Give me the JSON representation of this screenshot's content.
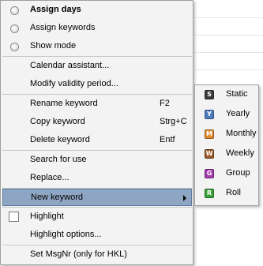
{
  "menu": {
    "mode_items": [
      {
        "label": "Assign days"
      },
      {
        "label": "Assign keywords"
      },
      {
        "label": "Show mode"
      }
    ],
    "calendar_assistant": "Calendar assistant...",
    "modify_validity": "Modify validity period...",
    "rename_keyword": {
      "label": "Rename keyword",
      "shortcut": "F2"
    },
    "copy_keyword": {
      "label": "Copy keyword",
      "shortcut": "Strg+C"
    },
    "delete_keyword": {
      "label": "Delete keyword",
      "shortcut": "Entf"
    },
    "search_for_use": "Search for use",
    "replace": "Replace...",
    "new_keyword": "New keyword",
    "highlight": "Highlight",
    "highlight_options": "Highlight options...",
    "set_msgnr": "Set MsgNr (only for HKL)"
  },
  "submenu": {
    "items": [
      {
        "label": "Static",
        "letter": "S",
        "color": "#3b3b3b"
      },
      {
        "label": "Yearly",
        "letter": "Y",
        "color": "#4f7bbf"
      },
      {
        "label": "Monthly",
        "letter": "M",
        "color": "#e08a2e"
      },
      {
        "label": "Weekly",
        "letter": "W",
        "color": "#9c5a2a"
      },
      {
        "label": "Group",
        "letter": "G",
        "color": "#a43cb0"
      },
      {
        "label": "Roll",
        "letter": "R",
        "color": "#3aa23a"
      }
    ]
  }
}
